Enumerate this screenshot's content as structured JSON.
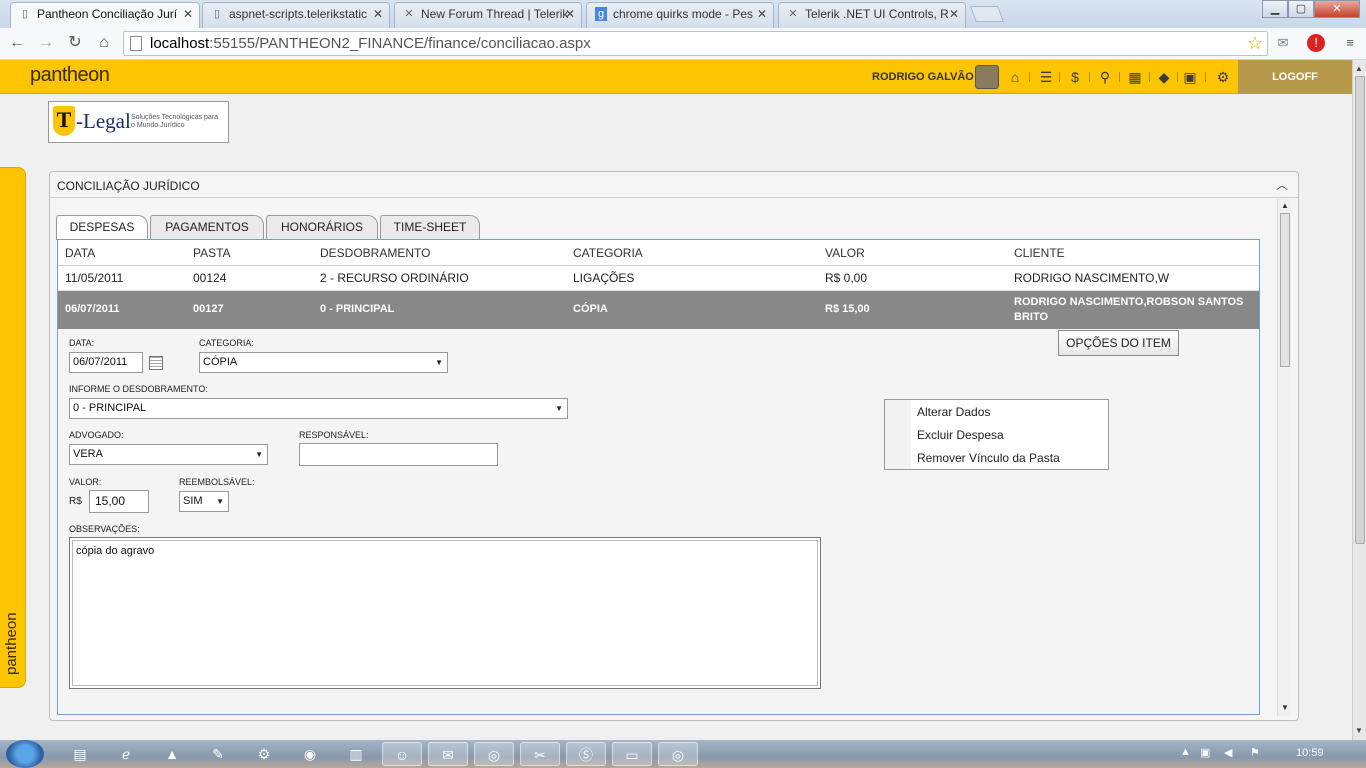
{
  "browser": {
    "tabs": [
      {
        "title": "Pantheon Conciliação Jurí",
        "active": true,
        "icon": "page-icon"
      },
      {
        "title": "aspnet-scripts.telerikstatic",
        "active": false,
        "icon": "page-icon"
      },
      {
        "title": "New Forum Thread | Telerik",
        "active": false,
        "icon": "telerik-icon"
      },
      {
        "title": "chrome quirks mode - Pes",
        "active": false,
        "icon": "google-icon"
      },
      {
        "title": "Telerik .NET UI Controls, R",
        "active": false,
        "icon": "telerik-icon"
      }
    ],
    "url_host": "localhost",
    "url_rest": ":55155/PANTHEON2_FINANCE/finance/conciliacao.aspx"
  },
  "header": {
    "brand": "pantheon",
    "username": "RODRIGO GALVÃO",
    "logoff": "LOGOFF",
    "icons": [
      "home-icon",
      "list-icon",
      "dollar-icon",
      "search-icon",
      "calendar-icon",
      "tags-icon",
      "inbox-icon",
      "gear-icon"
    ]
  },
  "sidetab": {
    "label": "pantheon"
  },
  "logo": {
    "letter": "T",
    "text": "-Legal",
    "tagline": "Soluções Tecnológicas para o Mundo Jurídico"
  },
  "panel": {
    "title": "CONCILIAÇÃO JURÍDICO",
    "tabs": [
      "DESPESAS",
      "PAGAMENTOS",
      "HONORÁRIOS",
      "TIME-SHEET"
    ],
    "columns": [
      "DATA",
      "PASTA",
      "DESDOBRAMENTO",
      "CATEGORIA",
      "VALOR",
      "CLIENTE"
    ],
    "rows": [
      {
        "data": "11/05/2011",
        "pasta": "00124",
        "desdobramento": "2 - RECURSO ORDINÁRIO",
        "categoria": "LIGAÇÕES",
        "valor": "R$ 0,00",
        "cliente": "RODRIGO NASCIMENTO,W"
      },
      {
        "data": "06/07/2011",
        "pasta": "00127",
        "desdobramento": "0 - PRINCIPAL",
        "categoria": "CÓPIA",
        "valor": "R$ 15,00",
        "cliente": "RODRIGO NASCIMENTO,ROBSON SANTOS BRITO"
      }
    ],
    "form": {
      "data_label": "DATA:",
      "data_value": "06/07/2011",
      "categoria_label": "CATEGORIA:",
      "categoria_value": "CÓPIA",
      "desdobramento_label": "INFORME O DESDOBRAMENTO:",
      "desdobramento_value": "0 - PRINCIPAL",
      "advogado_label": "ADVOGADO:",
      "advogado_value": "VERA",
      "responsavel_label": "RESPONSÁVEL:",
      "responsavel_value": "",
      "valor_label": "VALOR:",
      "currency": "R$",
      "valor_value": "15,00",
      "reembolsavel_label": "REEMBOLSÁVEL:",
      "reembolsavel_value": "SIM",
      "observacoes_label": "OBSERVAÇÕES:",
      "observacoes_value": "cópia do agravo",
      "options_button": "OPÇÕES DO ITEM",
      "menu": [
        "Alterar Dados",
        "Excluir Despesa",
        "Remover Vínculo da Pasta"
      ]
    }
  },
  "taskbar": {
    "clock": "10:59"
  },
  "colors": {
    "brand_yellow": "#fdc400",
    "selected_row": "#888888",
    "grid_border": "#7a9cc6"
  }
}
